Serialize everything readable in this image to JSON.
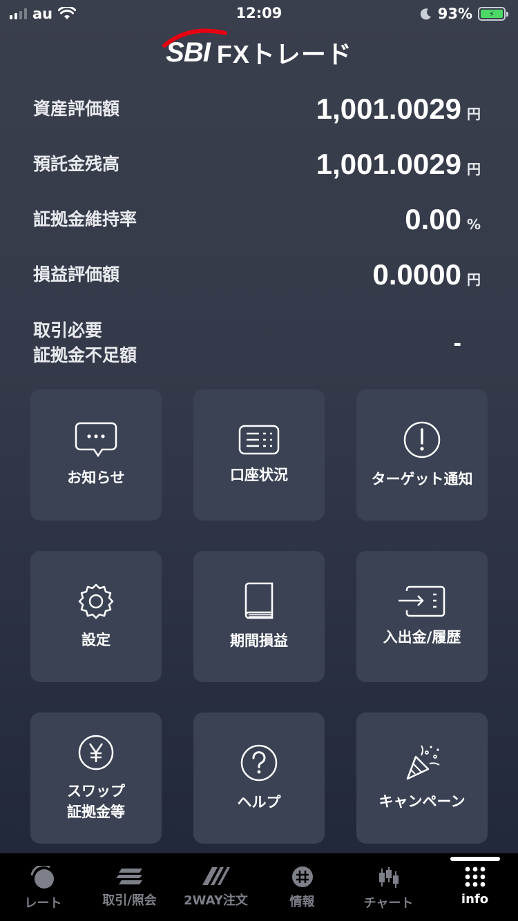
{
  "status_bar": {
    "carrier": "au",
    "time": "12:09",
    "battery_percent": "93%",
    "battery_level": 0.93,
    "icons": [
      "signal-icon",
      "wifi-icon",
      "moon-icon",
      "battery-icon"
    ]
  },
  "logo": {
    "brand": "SBI",
    "product": "FXトレード",
    "accent_color": "#e60012"
  },
  "summary": [
    {
      "label": "資産評価額",
      "value": "1,001.0029",
      "unit": "円"
    },
    {
      "label": "預託金残高",
      "value": "1,001.0029",
      "unit": "円"
    },
    {
      "label": "証拠金維持率",
      "value": "0.00",
      "unit": "%"
    },
    {
      "label": "損益評価額",
      "value": "0.0000",
      "unit": "円"
    },
    {
      "label": "取引必要\n証拠金不足額",
      "value": "-",
      "unit": ""
    }
  ],
  "menu": [
    {
      "label": "お知らせ",
      "icon": "speech-bubble-icon"
    },
    {
      "label": "口座状況",
      "icon": "list-card-icon"
    },
    {
      "label": "ターゲット通知",
      "icon": "exclamation-circle-icon"
    },
    {
      "label": "設定",
      "icon": "gear-icon"
    },
    {
      "label": "期間損益",
      "icon": "book-icon"
    },
    {
      "label": "入出金/履歴",
      "icon": "transfer-icon"
    },
    {
      "label": "スワップ\n証拠金等",
      "icon": "yen-circle-icon"
    },
    {
      "label": "ヘルプ",
      "icon": "question-circle-icon"
    },
    {
      "label": "キャンペーン",
      "icon": "party-popper-icon"
    }
  ],
  "tabbar": [
    {
      "label": "レート",
      "icon": "rate-icon",
      "active": false
    },
    {
      "label": "取引/照会",
      "icon": "trade-icon",
      "active": false
    },
    {
      "label": "2WAY注文",
      "icon": "two-way-icon",
      "active": false
    },
    {
      "label": "情報",
      "icon": "info-globe-icon",
      "active": false
    },
    {
      "label": "チャート",
      "icon": "candlestick-icon",
      "active": false
    },
    {
      "label": "info",
      "icon": "grid-dots-icon",
      "active": true
    }
  ]
}
